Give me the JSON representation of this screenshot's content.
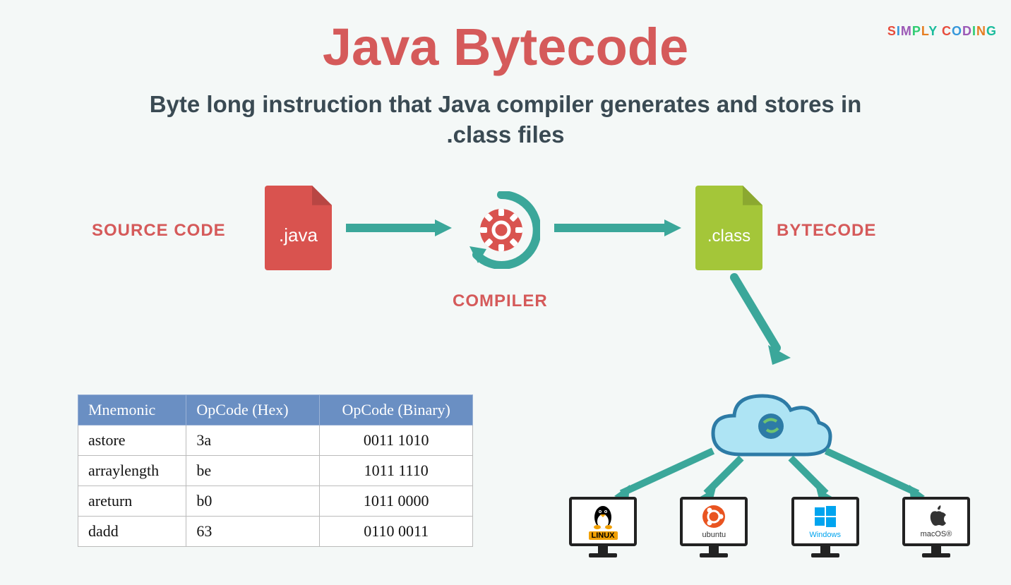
{
  "header": {
    "logo": "SIMPLY CODING",
    "title": "Java Bytecode",
    "subtitle": "Byte long instruction that Java compiler generates and stores in .class files"
  },
  "flow": {
    "source_label": "SOURCE CODE",
    "java_ext": ".java",
    "compiler_label": "COMPILER",
    "class_ext": ".class",
    "bytecode_label": "BYTECODE"
  },
  "table": {
    "headers": [
      "Mnemonic",
      "OpCode (Hex)",
      "OpCode (Binary)"
    ],
    "rows": [
      {
        "mnemonic": "astore",
        "hex": "3a",
        "bin": "0011 1010"
      },
      {
        "mnemonic": "arraylength",
        "hex": "be",
        "bin": "1011 1110"
      },
      {
        "mnemonic": "areturn",
        "hex": "b0",
        "bin": "1011 0000"
      },
      {
        "mnemonic": "dadd",
        "hex": "63",
        "bin": "0110 0011"
      }
    ]
  },
  "os": {
    "linux": "LINUX",
    "ubuntu": "ubuntu",
    "windows": "Windows",
    "macos": "macOS®"
  },
  "colors": {
    "title": "#d55a5a",
    "arrow": "#3ba79a",
    "table_header": "#6a8fc3",
    "java_file": "#d9534f",
    "class_file": "#a4c639"
  }
}
